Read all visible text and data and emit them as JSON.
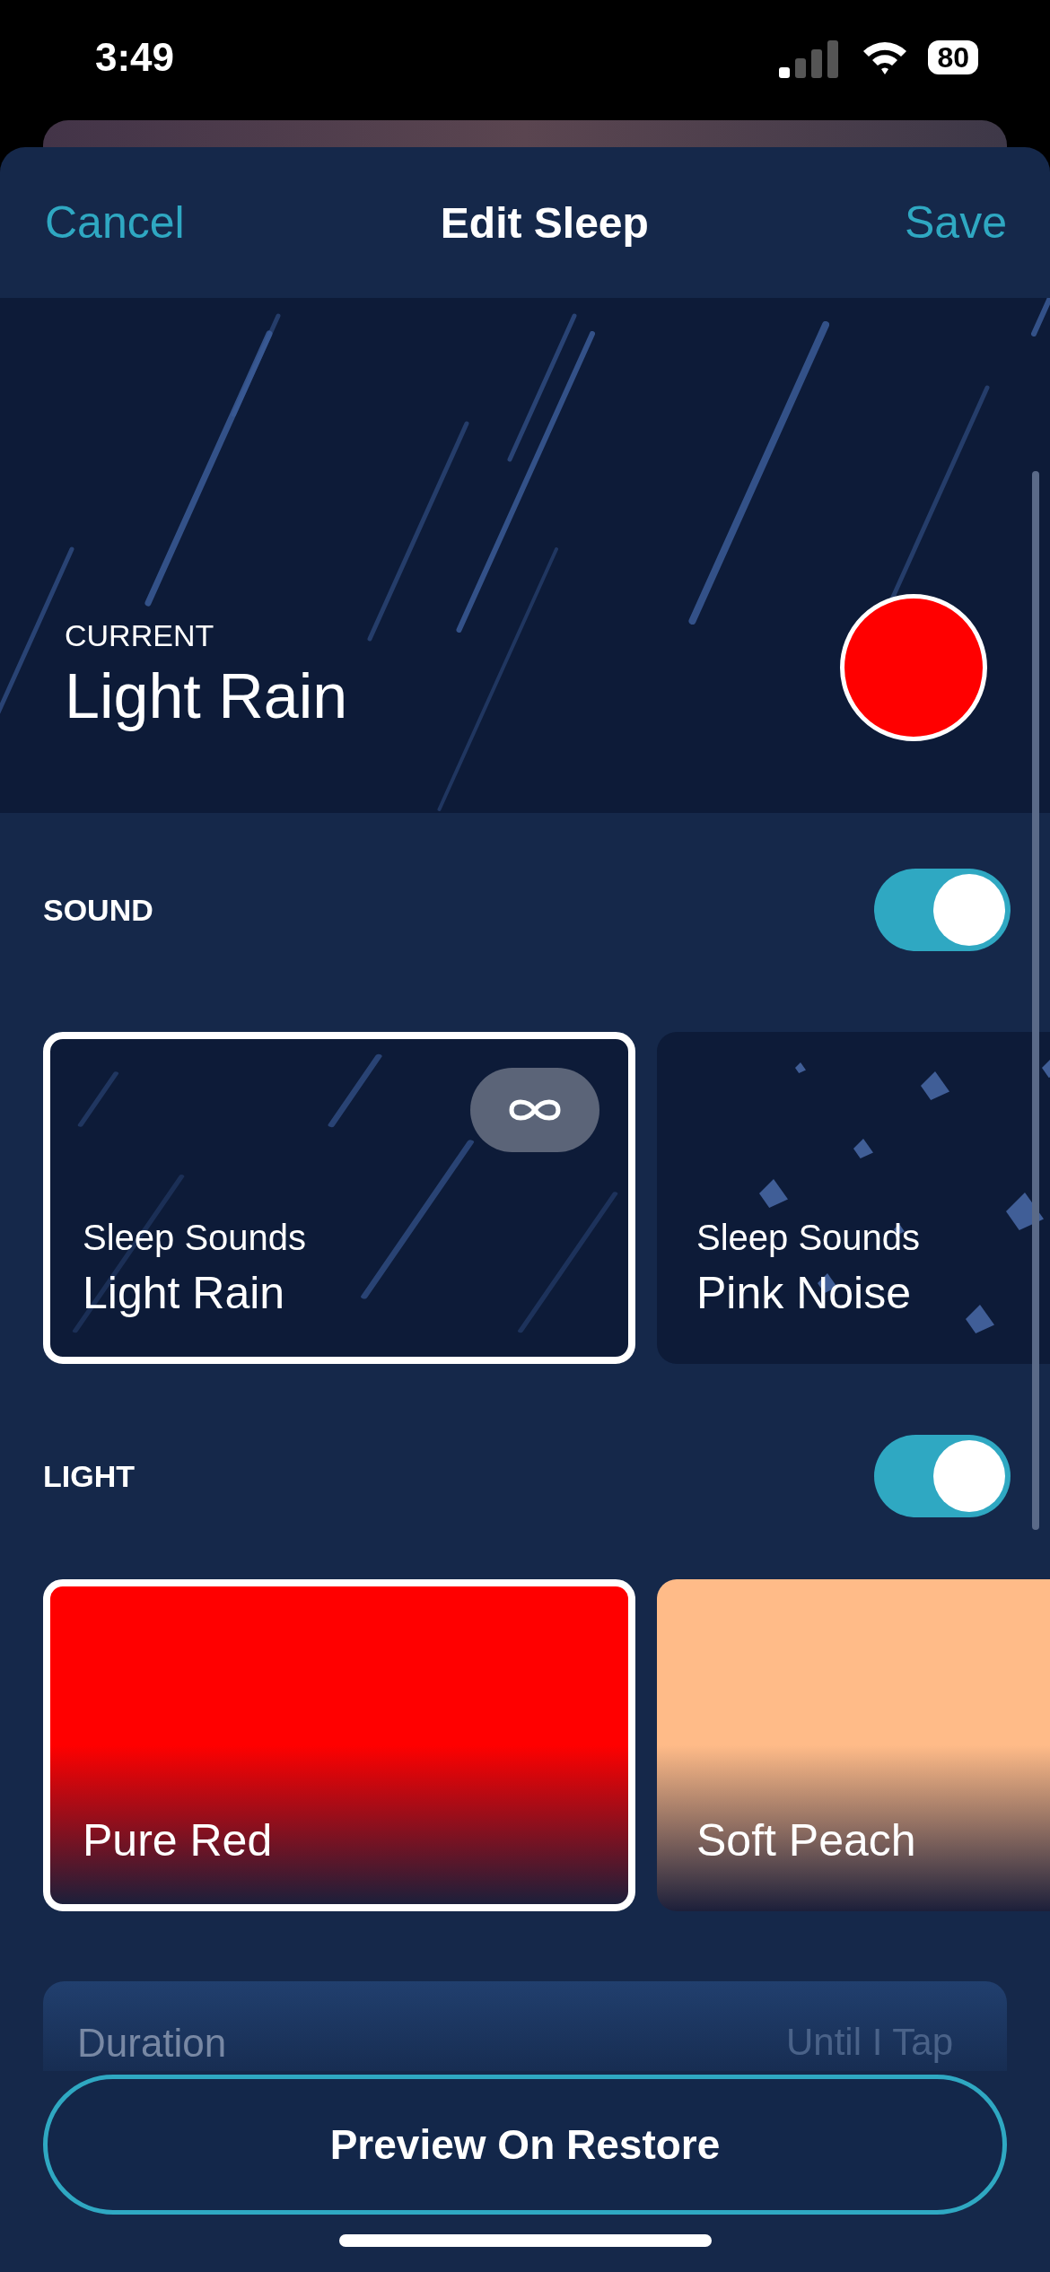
{
  "status_bar": {
    "time": "3:49",
    "battery": "80"
  },
  "header": {
    "cancel": "Cancel",
    "title": "Edit Sleep",
    "save": "Save"
  },
  "current": {
    "label": "CURRENT",
    "name": "Light Rain",
    "color": "#ff0000"
  },
  "sections": [
    {
      "title": "SOUND",
      "on": true,
      "cards": [
        {
          "kind": "rain",
          "category": "Sleep Sounds",
          "name": "Light Rain",
          "selected": true,
          "loop": true
        },
        {
          "kind": "noise",
          "category": "Sleep Sounds",
          "name": "Pink Noise",
          "selected": false,
          "loop": false
        }
      ]
    },
    {
      "title": "LIGHT",
      "on": true,
      "cards": [
        {
          "kind": "color",
          "name": "Pure Red",
          "color": "#ff0000",
          "selected": true
        },
        {
          "kind": "color",
          "name": "Soft Peach",
          "color": "#ffbb88",
          "selected": false
        }
      ]
    }
  ],
  "duration": {
    "label": "Duration",
    "value": "Until I Tap"
  },
  "preview_button": "Preview On Restore"
}
